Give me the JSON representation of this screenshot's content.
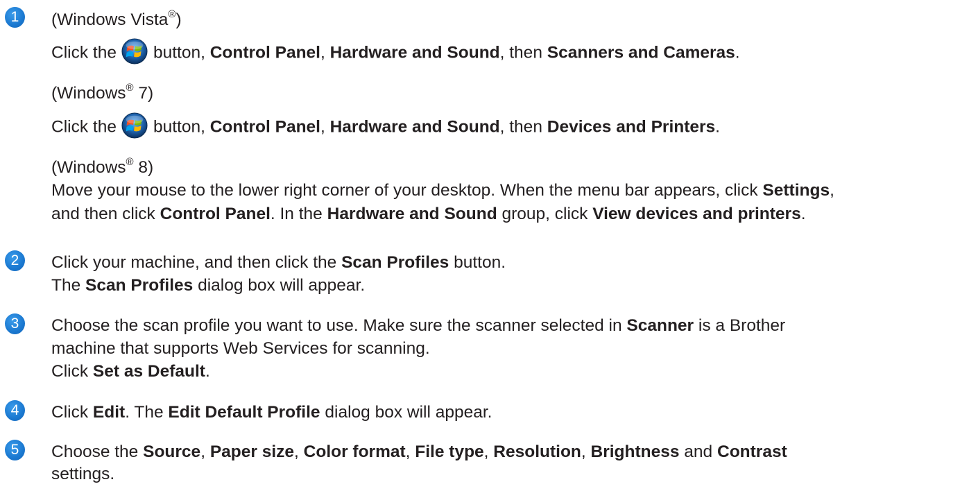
{
  "steps": [
    {
      "number": "1",
      "lines": {
        "vista_heading_pre": "(Windows Vista",
        "vista_heading_reg": "®",
        "vista_heading_post": ")",
        "vista_click_the": "Click the",
        "vista_button": "button,",
        "control_panel": "Control Panel",
        "comma": ",",
        "hardware_and_sound": "Hardware and Sound",
        "then": ", then",
        "scanners_and_cameras": "Scanners and Cameras",
        "period": ".",
        "win7_heading_pre": "(Windows",
        "win7_heading_reg": "®",
        "win7_heading_post": " 7)",
        "win7_click_the": "Click the",
        "win7_button": "button,",
        "devices_and_printers": "Devices and Printers",
        "win8_heading_pre": "(Windows",
        "win8_heading_reg": "®",
        "win8_heading_post": " 8)",
        "win8_line1_pre": "Move your mouse to the lower right corner of your desktop. When the menu bar appears, click",
        "settings": "Settings",
        "win8_line2_pre": "and then click",
        "win8_line2_mid": ". In the",
        "win8_line2_group": "group, click",
        "view_devices_and_printers": "View devices and printers"
      }
    },
    {
      "number": "2",
      "lines": {
        "l1_pre": "Click your machine, and then click the",
        "scan_profiles": "Scan Profiles",
        "l1_post": "button.",
        "l2_pre": "The",
        "l2_post": "dialog box will appear."
      }
    },
    {
      "number": "3",
      "lines": {
        "l1_pre": "Choose the scan profile you want to use. Make sure the scanner selected in",
        "scanner": "Scanner",
        "l1_post": "is a Brother",
        "l2": "machine that supports Web Services for scanning.",
        "l3_pre": "Click",
        "set_as_default": "Set as Default",
        "period": "."
      }
    },
    {
      "number": "4",
      "lines": {
        "l1_pre": "Click",
        "edit": "Edit",
        "l1_mid": ". The",
        "edit_default_profile": "Edit Default Profile",
        "l1_post": "dialog box will appear."
      }
    },
    {
      "number": "5",
      "lines": {
        "l1_pre": "Choose the",
        "source": "Source",
        "paper_size": "Paper size",
        "color_format": "Color format",
        "file_type": "File type",
        "resolution": "Resolution",
        "brightness": "Brightness",
        "and": "and",
        "contrast": "Contrast",
        "comma": ",",
        "l2": "settings."
      }
    }
  ],
  "icons": {
    "windows_start_orb": "windows-start-orb-icon"
  }
}
